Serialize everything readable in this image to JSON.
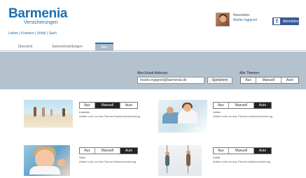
{
  "brand": {
    "name": "Barmenia",
    "sub": "Versicherungen",
    "slogan": "Leben | Kranken | Unfall | Sach"
  },
  "user": {
    "label": "Newsletter",
    "name": "Martin Ingignoli",
    "facebook_label": "Abmelden"
  },
  "tabs": [
    {
      "label": "Übersicht",
      "active": false
    },
    {
      "label": "Seiteneinstellungen",
      "active": false
    },
    {
      "label": "Abo",
      "active": true
    }
  ],
  "subscription": {
    "email_label": "Abo-Email-Adresse:",
    "email_value": "martin.ingignoli@barmenia.de",
    "save_label": "Speichern",
    "all_topics_label": "Alle Themen:",
    "options": [
      "Aus",
      "Manuell",
      "Auto"
    ]
  },
  "topics": [
    {
      "title": "Kranken",
      "description": "Artikel rund um das Thema Krankenversicherung",
      "selected": "Manuell",
      "image": "beach-family"
    },
    {
      "title": "Leben",
      "description": "Artikel rund um das Thema Lebensversicherung",
      "selected": "Auto",
      "image": "couple"
    },
    {
      "title": "Sach",
      "description": "Artikel rund um das Thema Sachversicherung",
      "selected": "Auto",
      "image": "child"
    },
    {
      "title": "Unfall",
      "description": "Artikel rund um das Thema Unfallversicherung",
      "selected": "Auto",
      "image": "climbers"
    }
  ],
  "colors": {
    "brand": "#1c6fb2",
    "toolbar_bg": "#b4c2ce",
    "facebook": "#3b5998",
    "selected_segment": "#222222"
  }
}
